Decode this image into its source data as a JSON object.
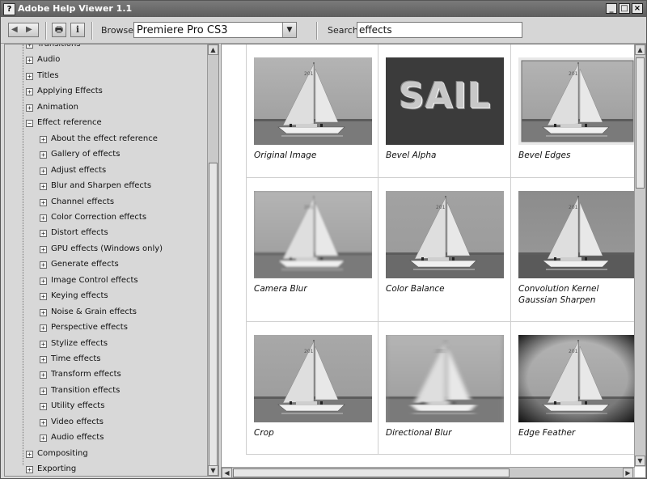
{
  "window": {
    "title": "Adobe Help Viewer 1.1",
    "app_icon_glyph": "?",
    "controls": {
      "minimize": "_",
      "maximize": "□",
      "close": "×"
    }
  },
  "toolbar": {
    "back_icon": "◀",
    "forward_icon": "▶",
    "print_icon": "🖶",
    "info_icon": "i",
    "browse_label": "Browse",
    "browse_value": "Premiere Pro CS3",
    "dropdown_icon": "▼",
    "search_label": "Search",
    "search_value": "effects"
  },
  "sidebar": {
    "items": [
      {
        "label": "Transitions",
        "expanded": false,
        "level": 0,
        "partial": true
      },
      {
        "label": "Audio",
        "expanded": false,
        "level": 0
      },
      {
        "label": "Titles",
        "expanded": false,
        "level": 0
      },
      {
        "label": "Applying Effects",
        "expanded": false,
        "level": 0
      },
      {
        "label": "Animation",
        "expanded": false,
        "level": 0
      },
      {
        "label": "Effect reference",
        "expanded": true,
        "level": 0
      },
      {
        "label": "About the effect reference",
        "expanded": false,
        "level": 1
      },
      {
        "label": "Gallery of effects",
        "expanded": false,
        "level": 1
      },
      {
        "label": "Adjust effects",
        "expanded": false,
        "level": 1
      },
      {
        "label": "Blur and Sharpen effects",
        "expanded": false,
        "level": 1
      },
      {
        "label": "Channel effects",
        "expanded": false,
        "level": 1
      },
      {
        "label": "Color Correction effects",
        "expanded": false,
        "level": 1
      },
      {
        "label": "Distort effects",
        "expanded": false,
        "level": 1
      },
      {
        "label": "GPU effects (Windows only)",
        "expanded": false,
        "level": 1
      },
      {
        "label": "Generate effects",
        "expanded": false,
        "level": 1
      },
      {
        "label": "Image Control effects",
        "expanded": false,
        "level": 1
      },
      {
        "label": "Keying effects",
        "expanded": false,
        "level": 1
      },
      {
        "label": "Noise & Grain effects",
        "expanded": false,
        "level": 1
      },
      {
        "label": "Perspective effects",
        "expanded": false,
        "level": 1
      },
      {
        "label": "Stylize effects",
        "expanded": false,
        "level": 1
      },
      {
        "label": "Time effects",
        "expanded": false,
        "level": 1
      },
      {
        "label": "Transform effects",
        "expanded": false,
        "level": 1
      },
      {
        "label": "Transition effects",
        "expanded": false,
        "level": 1
      },
      {
        "label": "Utility effects",
        "expanded": false,
        "level": 1
      },
      {
        "label": "Video effects",
        "expanded": false,
        "level": 1
      },
      {
        "label": "Audio effects",
        "expanded": false,
        "level": 1
      },
      {
        "label": "Compositing",
        "expanded": false,
        "level": 0
      },
      {
        "label": "Exporting",
        "expanded": false,
        "level": 0
      }
    ],
    "expand_glyph": "+",
    "collapse_glyph": "−"
  },
  "scroll_arrows": {
    "up": "▲",
    "down": "▼",
    "left": "◀",
    "right": "▶"
  },
  "gallery": {
    "items": [
      {
        "caption": "Original Image",
        "effect": "original"
      },
      {
        "caption": "Bevel Alpha",
        "effect": "bevel-alpha",
        "image_text": "SAIL"
      },
      {
        "caption": "Bevel Edges",
        "effect": "bevel-edges"
      },
      {
        "caption": "Camera Blur",
        "effect": "camera-blur"
      },
      {
        "caption": "Color Balance",
        "effect": "color-balance"
      },
      {
        "caption": "Convolution Kernel Gaussian Sharpen",
        "effect": "sharpen"
      },
      {
        "caption": "Crop",
        "effect": "crop"
      },
      {
        "caption": "Directional Blur",
        "effect": "directional-blur"
      },
      {
        "caption": "Edge Feather",
        "effect": "edge-feather"
      }
    ]
  }
}
